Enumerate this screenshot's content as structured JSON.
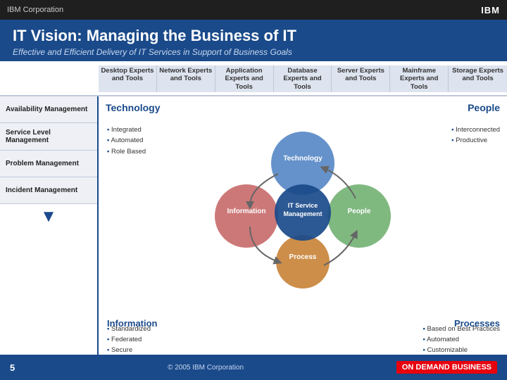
{
  "header": {
    "company": "IBM Corporation",
    "ibm_label": "IBM"
  },
  "title": {
    "main": "IT Vision: Managing the Business of IT",
    "subtitle": "Effective and Efficient Delivery of IT Services in Support of Business Goals"
  },
  "columns": [
    "Desktop Experts and Tools",
    "Network Experts and Tools",
    "Application Experts and Tools",
    "Database Experts and Tools",
    "Server Experts and Tools",
    "Mainframe Experts and Tools",
    "Storage Experts and Tools"
  ],
  "management_items": [
    "Availability Management",
    "Service Level Management",
    "Problem Management",
    "Incident Management"
  ],
  "sections": {
    "technology": {
      "label": "Technology",
      "bullets": [
        "Integrated",
        "Automated",
        "Role Based"
      ]
    },
    "people": {
      "label": "People",
      "bullets": [
        "Interconnected",
        "Productive"
      ]
    },
    "information": {
      "label": "Information",
      "bullets": [
        "Standardized",
        "Federated",
        "Secure"
      ]
    },
    "processes": {
      "label": "Processes",
      "bullets": [
        "Based on Best Practices",
        "Automated",
        "Customizable"
      ]
    },
    "center": "IT Service Management"
  },
  "diagram_labels": {
    "technology": "Technology",
    "people": "People",
    "information": "Information",
    "process": "Process"
  },
  "footer": {
    "page_number": "5",
    "copyright": "© 2005 IBM Corporation",
    "brand": "ON DEMAND BUSINESS"
  }
}
